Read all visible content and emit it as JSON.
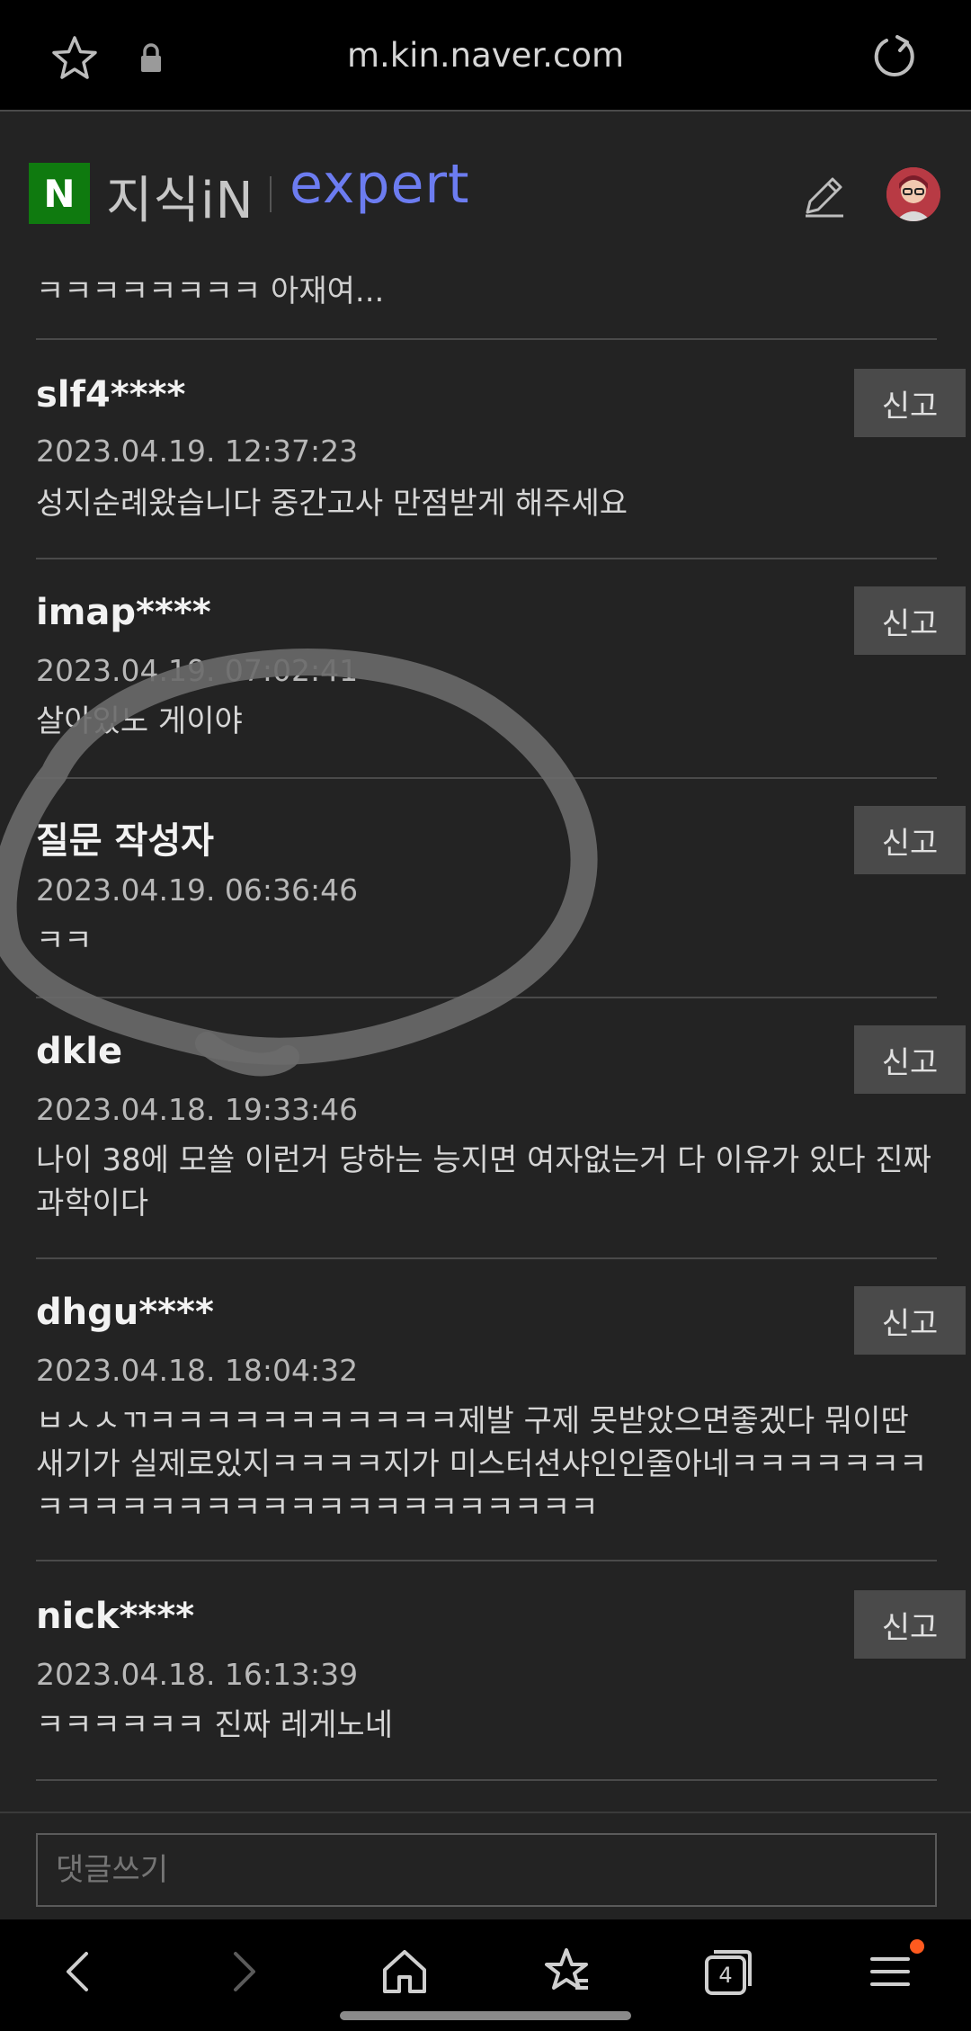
{
  "browser": {
    "url": "m.kin.naver.com"
  },
  "header": {
    "logo_letter": "N",
    "brand_kin": "지식iN",
    "brand_expert": "expert"
  },
  "comments": {
    "truncated_text": "ㅋㅋㅋㅋㅋㅋㅋㅋ 아재여...",
    "report_label": "신고",
    "items": [
      {
        "user": "slf4****",
        "date": "2023.04.19. 12:37:23",
        "text": "성지순례왔습니다 중간고사 만점받게 해주세요"
      },
      {
        "user": "imap****",
        "date": "2023.04.19. 07:02:41",
        "text": "살아있노 게이야"
      },
      {
        "user": "질문 작성자",
        "date": "2023.04.19. 06:36:46",
        "text": "ㅋㅋ"
      },
      {
        "user": "dkle",
        "date": "2023.04.18. 19:33:46",
        "text": "나이 38에 모쏠 이런거 당하는 능지면 여자없는거 다 이유가 있다 진짜 과학이다"
      },
      {
        "user": "dhgu****",
        "date": "2023.04.18. 18:04:32",
        "text": "ㅂㅅㅅㄲㅋㅋㅋㅋㅋㅋㅋㅋㅋㅋㅋ제발 구제 못받았으면좋겠다 뭐이딴새기가 실제로있지ㅋㅋㅋㅋ지가 미스터션샤인인줄아네ㅋㅋㅋㅋㅋㅋㅋㅋㅋㅋㅋㅋㅋㅋㅋㅋㅋㅋㅋㅋㅋㅋㅋㅋㅋㅋㅋ"
      },
      {
        "user": "nick****",
        "date": "2023.04.18. 16:13:39",
        "text": "ㅋㅋㅋㅋㅋㅋ 진짜 레게노네"
      }
    ]
  },
  "input": {
    "placeholder": "댓글쓰기"
  },
  "bottom_nav": {
    "tab_count": "4",
    "accent_color": "#ff5a1f"
  },
  "colors": {
    "background": "#232323",
    "expert_brand": "#6c7cf0",
    "naver_green": "#0f7a0f"
  }
}
